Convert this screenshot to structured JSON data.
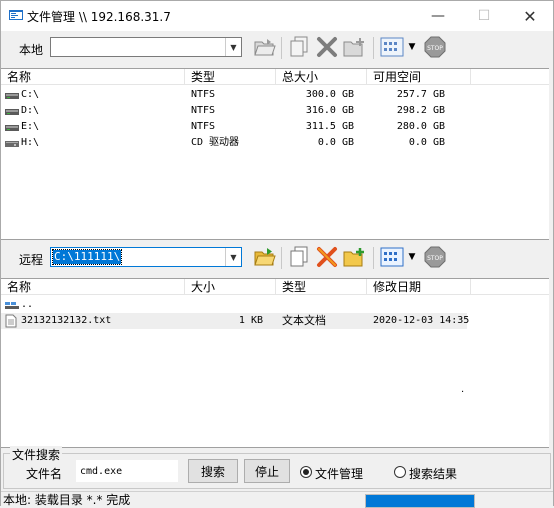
{
  "window": {
    "title": "文件管理 \\\\ 192.168.31.7",
    "minimize": "—",
    "maximize": "☐",
    "close": "✕"
  },
  "local": {
    "label": "本地",
    "path_value": "",
    "columns": [
      "名称",
      "类型",
      "总大小",
      "可用空间"
    ],
    "rows": [
      {
        "name": "C:\\",
        "type": "NTFS",
        "total": "300.0 GB",
        "free": "257.7 GB",
        "icon": "drive-icon"
      },
      {
        "name": "D:\\",
        "type": "NTFS",
        "total": "316.0 GB",
        "free": "298.2 GB",
        "icon": "drive-icon"
      },
      {
        "name": "E:\\",
        "type": "NTFS",
        "total": "311.5 GB",
        "free": "280.0 GB",
        "icon": "drive-icon"
      },
      {
        "name": "H:\\",
        "type": "CD 驱动器",
        "total": "0.0 GB",
        "free": "0.0 GB",
        "icon": "cd-drive-icon"
      }
    ]
  },
  "remote": {
    "label": "远程",
    "path_value": "C:\\111111\\",
    "columns": [
      "名称",
      "大小",
      "类型",
      "修改日期"
    ],
    "rows": [
      {
        "name": "..",
        "size": "",
        "type": "",
        "modified": "",
        "icon": "parent-folder-icon"
      },
      {
        "name": "32132132132.txt",
        "size": "1 KB",
        "type": "文本文档",
        "modified": "2020-12-03 14:35",
        "icon": "text-file-icon"
      }
    ],
    "dot": "·"
  },
  "search": {
    "group_title": "文件搜索",
    "filename_label": "文件名",
    "filename_value": "cmd.exe",
    "search_button": "搜索",
    "stop_button": "停止",
    "radio_file_manage": "文件管理",
    "radio_search_results": "搜索结果",
    "selected": "file_manage"
  },
  "status": {
    "text": "本地: 装载目录 *.* 完成",
    "progress": 1.0
  },
  "toolbar_icons": [
    "open-folder-icon",
    "copy-icon",
    "delete-icon",
    "new-folder-icon",
    "view-mode-icon",
    "stop-icon"
  ],
  "colors": {
    "accent": "#0078d7",
    "delete_red": "#d03a1a",
    "delete_orange": "#f08a00",
    "folder_yellow": "#f0c040"
  }
}
